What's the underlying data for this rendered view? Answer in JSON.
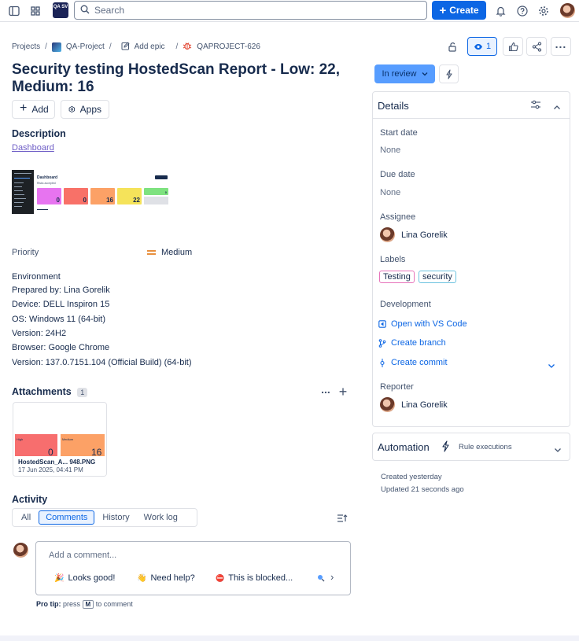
{
  "topbar": {
    "logo_text": "QA SV",
    "search_placeholder": "Search",
    "create_label": "Create"
  },
  "breadcrumb": {
    "projects": "Projects",
    "project": "QA-Project",
    "add_epic": "Add epic",
    "issue_key": "QAPROJECT-626"
  },
  "actions": {
    "watch_count": "1"
  },
  "issue": {
    "title": "Security testing HostedScan Report - Low: 22, Medium: 16",
    "add_label": "Add",
    "apps_label": "Apps",
    "description_heading": "Description",
    "description_link": "Dashboard",
    "dashboard_thumbnail": {
      "title": "Dashboard",
      "subtitle": "Risks accepted",
      "cards": [
        {
          "label": "Critical",
          "value": "0",
          "color": "#e774f0"
        },
        {
          "label": "High",
          "value": "0",
          "color": "#f87168"
        },
        {
          "label": "Medium",
          "value": "16",
          "color": "#fca166"
        },
        {
          "label": "Low",
          "value": "22",
          "color": "#f5e35a"
        },
        {
          "label": "Accepted",
          "value": "0",
          "color": "#7ee27f"
        }
      ]
    },
    "priority_label": "Priority",
    "priority_value": "Medium",
    "environment_lines": [
      "Environment",
      "Prepared by: Lina Gorelik",
      "Device: DELL Inspiron 15",
      "OS: Windows 11 (64-bit)",
      "Version: 24H2",
      "Browser: Google Chrome",
      "Version: 137.0.7151.104 (Official Build) (64-bit)"
    ]
  },
  "attachments": {
    "heading": "Attachments",
    "count": "1",
    "file": {
      "name": "HostedScan_A... 948.PNG",
      "date": "17 Jun 2025, 04:41 PM",
      "preview_labels": [
        "High",
        "Medium"
      ],
      "preview_values": [
        "0",
        "16"
      ]
    }
  },
  "activity": {
    "heading": "Activity",
    "tabs": [
      "All",
      "Comments",
      "History",
      "Work log"
    ],
    "active_tab": "Comments",
    "comment_placeholder": "Add a comment...",
    "quick_replies": [
      {
        "icon": "🎉",
        "label": "Looks good!"
      },
      {
        "icon": "👋",
        "label": "Need help?"
      },
      {
        "icon": "⛔",
        "label": "This is blocked..."
      }
    ],
    "protip_bold": "Pro tip:",
    "protip_press": "press",
    "protip_key": "M",
    "protip_rest": "to comment"
  },
  "sidebar": {
    "status": "In review",
    "details_heading": "Details",
    "start_date_label": "Start date",
    "start_date_value": "None",
    "due_date_label": "Due date",
    "due_date_value": "None",
    "assignee_label": "Assignee",
    "assignee_name": "Lina Gorelik",
    "labels_label": "Labels",
    "labels": [
      "Testing",
      "security"
    ],
    "development_label": "Development",
    "dev_links": [
      "Open with VS Code",
      "Create branch",
      "Create commit"
    ],
    "reporter_label": "Reporter",
    "reporter_name": "Lina Gorelik",
    "automation_heading": "Automation",
    "rule_executions": "Rule executions",
    "created": "Created yesterday",
    "updated": "Updated 21 seconds ago"
  },
  "colors": {
    "brand_blue": "#0c66e4",
    "status_blue": "#579dff",
    "priority_orange": "#e2740f"
  }
}
